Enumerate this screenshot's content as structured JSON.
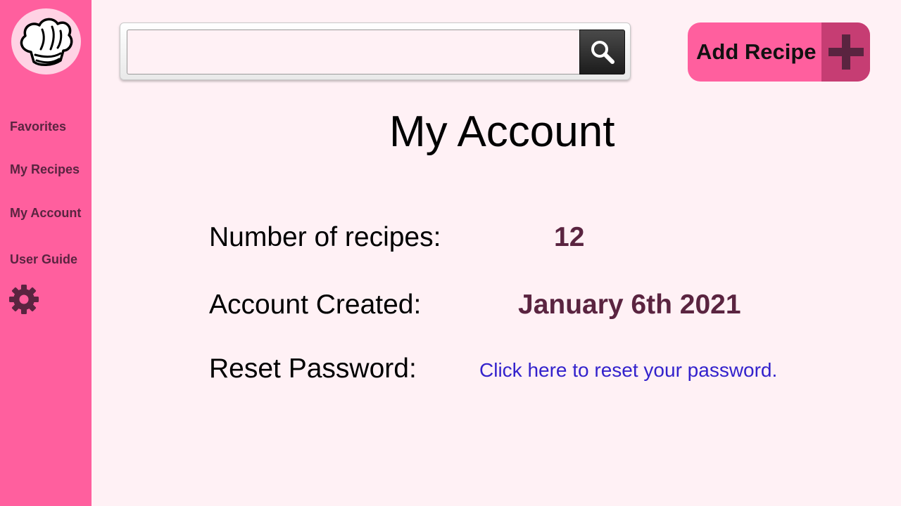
{
  "app": {
    "logo_icon": "chef-hat-icon"
  },
  "sidebar": {
    "items": [
      {
        "label": "Favorites"
      },
      {
        "label": "My Recipes"
      },
      {
        "label": "My Account"
      },
      {
        "label": "User Guide"
      }
    ],
    "settings_icon": "gear-icon"
  },
  "search": {
    "value": "",
    "placeholder": "",
    "button_icon": "search-icon"
  },
  "header": {
    "add_recipe_label": "Add Recipe",
    "add_recipe_icon": "plus-icon"
  },
  "main": {
    "title": "My Account",
    "recipes_label": "Number of recipes:",
    "recipes_value": "12",
    "created_label": "Account Created:",
    "created_value": "January 6th 2021",
    "reset_label": "Reset Password:",
    "reset_link": "Click here to reset your password."
  },
  "colors": {
    "sidebar": "#ff5f9e",
    "background": "#fff1f5",
    "accent_dark": "#5a2440",
    "link": "#3322cc",
    "plus_block": "#c63d73"
  }
}
